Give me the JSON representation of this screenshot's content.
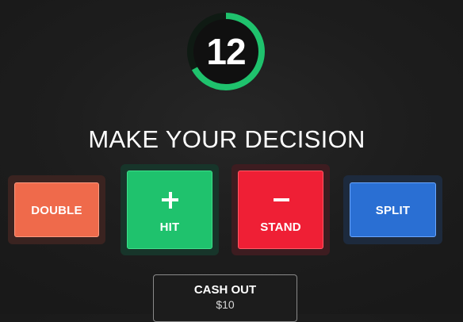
{
  "timer": {
    "value": "12",
    "progress_fraction": 0.67,
    "ring_color": "#1fc26d"
  },
  "prompt": "MAKE YOUR DECISION",
  "actions": {
    "double": {
      "label": "DOUBLE",
      "color": "#ef6a4b"
    },
    "hit": {
      "label": "HIT",
      "icon": "plus-icon",
      "color": "#1fc26d"
    },
    "stand": {
      "label": "STAND",
      "icon": "minus-icon",
      "color": "#ef1f35"
    },
    "split": {
      "label": "SPLIT",
      "color": "#2a6fd3"
    }
  },
  "cashout": {
    "label": "CASH OUT",
    "amount": "$10"
  }
}
